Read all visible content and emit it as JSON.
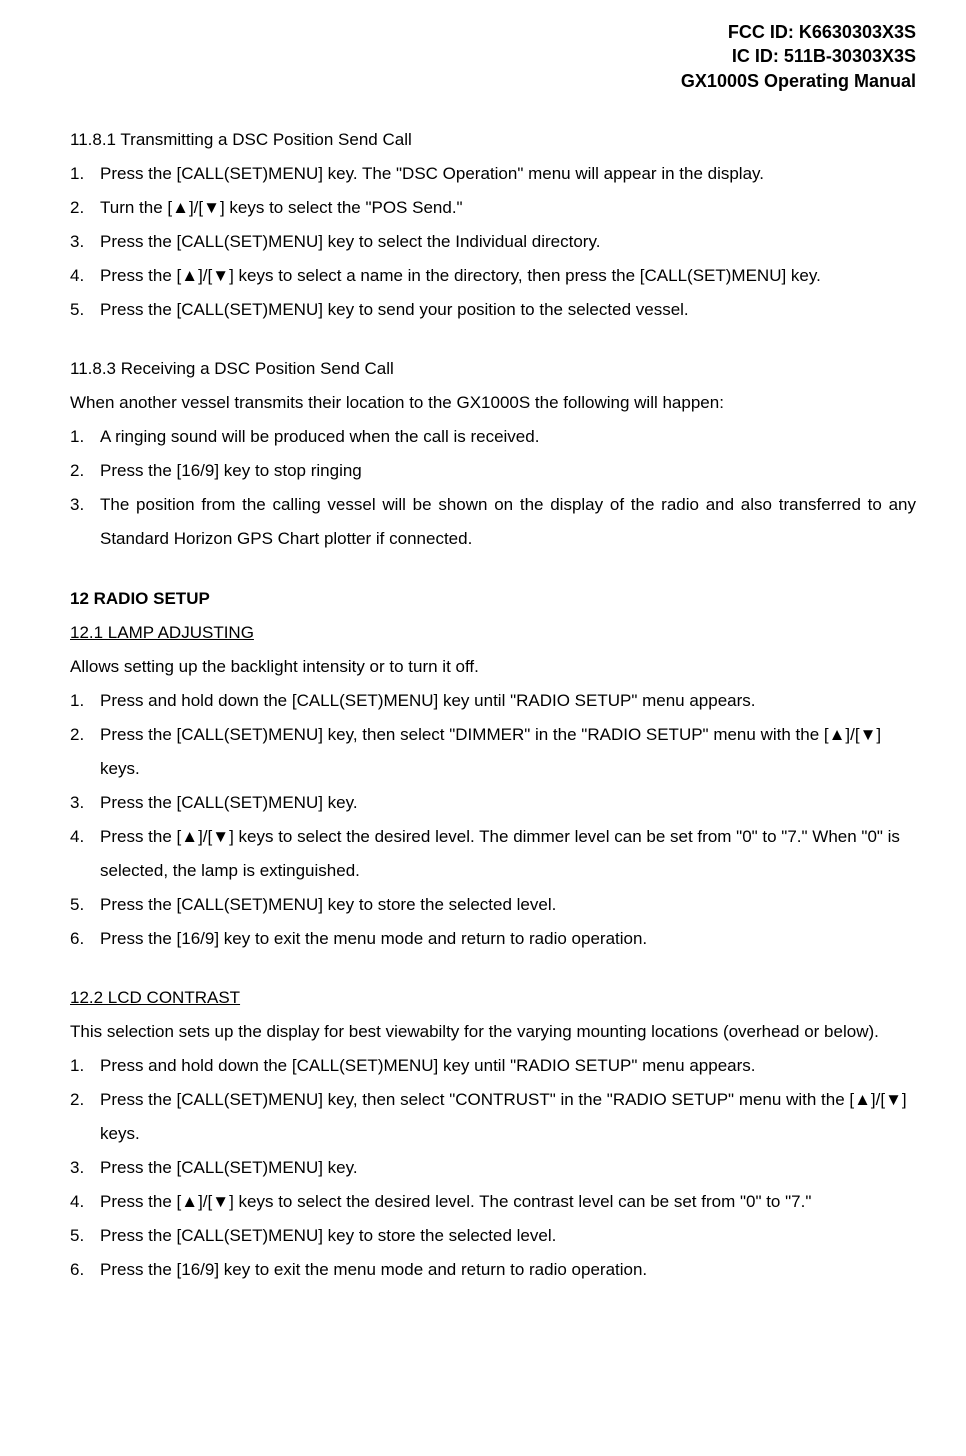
{
  "header": {
    "line1": "FCC ID: K6630303X3S",
    "line2": "IC ID: 511B-30303X3S",
    "line3": "GX1000S Operating Manual"
  },
  "sec1": {
    "title": "11.8.1 Transmitting a DSC Position Send Call",
    "steps": [
      "Press the [CALL(SET)MENU] key. The \"DSC Operation\" menu will appear in the display.",
      "Turn the [▲]/[▼] keys to select the \"POS Send.\"",
      "Press the [CALL(SET)MENU] key to select the Individual directory.",
      "Press the [▲]/[▼] keys to select a name in the directory, then press the [CALL(SET)MENU] key.",
      "Press the [CALL(SET)MENU] key to send your position to the selected vessel."
    ]
  },
  "sec2": {
    "title": "11.8.3 Receiving a DSC Position Send Call",
    "intro": "When another vessel transmits their location to the GX1000S the following will happen:",
    "steps": [
      "A ringing sound will be produced when the call is received.",
      "Press the [16/9] key to stop ringing",
      "The position from the calling vessel will be shown on the display of the radio and also transferred to any Standard Horizon GPS Chart plotter if connected."
    ]
  },
  "sec3": {
    "heading": "12  RADIO SETUP",
    "sub": "12.1  LAMP ADJUSTING",
    "intro": "Allows setting up the backlight intensity or to turn it off.",
    "steps": [
      "Press and hold down the [CALL(SET)MENU] key until \"RADIO SETUP\" menu appears.",
      "Press the [CALL(SET)MENU] key, then select \"DIMMER\" in the \"RADIO SETUP\" menu with the [▲]/[▼] keys.",
      "Press the [CALL(SET)MENU] key.",
      "Press the [▲]/[▼] keys to select the desired level. The dimmer level can be set from \"0\" to \"7.\" When \"0\" is selected, the lamp is extinguished.",
      "Press the [CALL(SET)MENU] key to store the selected level.",
      "Press the [16/9] key to exit the menu mode and return to radio operation."
    ]
  },
  "sec4": {
    "sub": "12.2   LCD CONTRAST",
    "intro": "This selection sets up the display for best viewabilty for the varying mounting locations (overhead or below).",
    "steps": [
      "Press and hold down the [CALL(SET)MENU] key until \"RADIO SETUP\" menu appears.",
      "Press the [CALL(SET)MENU] key, then select \"CONTRUST\" in the \"RADIO SETUP\" menu with the [▲]/[▼] keys.",
      "Press the [CALL(SET)MENU] key.",
      "Press the [▲]/[▼] keys to select the desired level. The contrast level can be set from \"0\" to \"7.\"",
      "Press the [CALL(SET)MENU] key to store the selected level.",
      "Press the [16/9] key to exit the menu mode and return to radio operation."
    ]
  }
}
